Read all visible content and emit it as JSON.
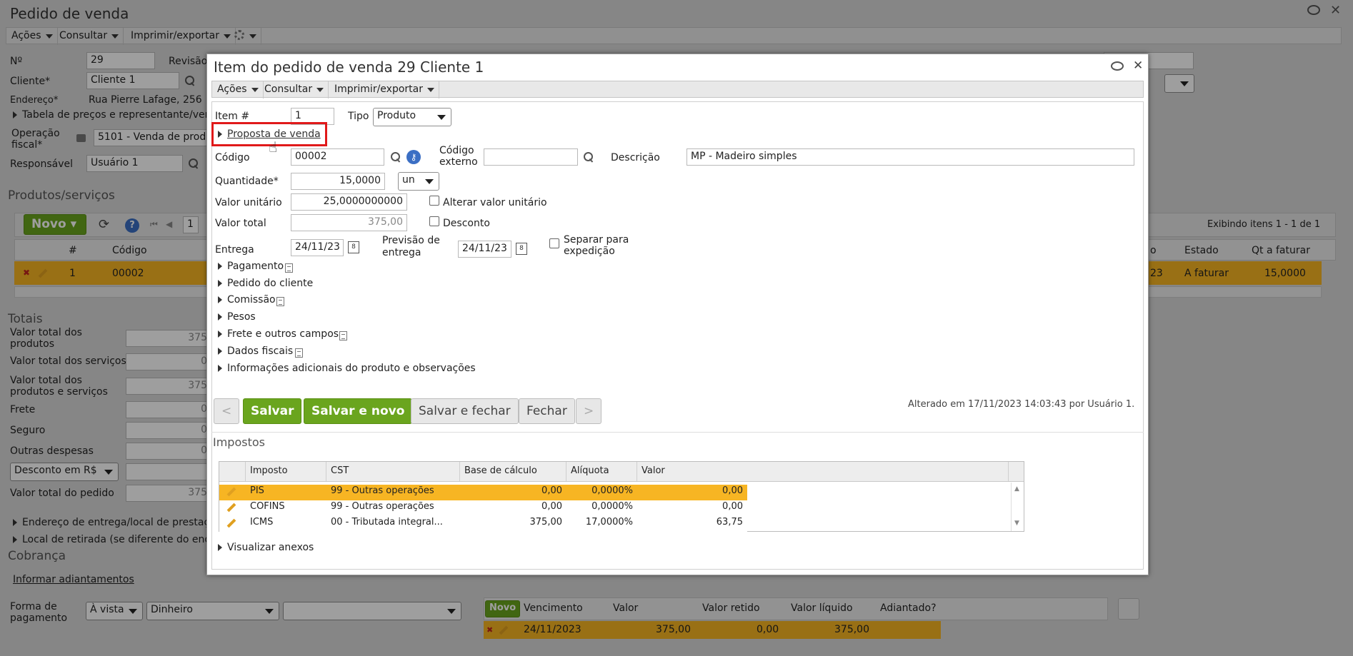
{
  "background": {
    "page_title": "Pedido de venda",
    "menu": [
      "Ações",
      "Consultar",
      "Imprimir/exportar"
    ],
    "fields": {
      "numero_label": "Nº",
      "numero_value": "29",
      "revisao_label": "Revisão",
      "cliente_label": "Cliente*",
      "cliente_value": "Cliente 1",
      "endereco_label": "Endereço*",
      "endereco_value": "Rua Pierre Lafage, 256",
      "tabela_label": "Tabela de preços e representante/vend",
      "operacao_label_1": "Operação",
      "operacao_label_2": "fiscal*",
      "operacao_value": "5101 - Venda de produ",
      "responsavel_label": "Responsável",
      "responsavel_value": "Usuário 1"
    },
    "produtos": {
      "section_title": "Produtos/serviços",
      "novo_label": "Novo",
      "page_value": "1",
      "exibindo": "Exibindo itens 1 - 1 de 1",
      "col_num": "#",
      "col_codigo": "Código",
      "col_o": "o",
      "col_estado": "Estado",
      "col_qt": "Qt a faturar",
      "row_num": "1",
      "row_codigo": "00002",
      "row_o": "23",
      "row_estado": "A faturar",
      "row_qt": "15,0000"
    },
    "totais": {
      "section_title": "Totais",
      "rows": [
        {
          "label_1": "Valor total dos",
          "label_2": "produtos",
          "value": "375"
        },
        {
          "label_1": "Valor total dos serviços",
          "label_2": "",
          "value": "0"
        },
        {
          "label_1": "Valor total dos",
          "label_2": "produtos e serviços",
          "value": "375"
        },
        {
          "label_1": "Frete",
          "label_2": "",
          "value": "0"
        },
        {
          "label_1": "Seguro",
          "label_2": "",
          "value": "0"
        },
        {
          "label_1": "Outras despesas",
          "label_2": "",
          "value": "0"
        },
        {
          "label_1": "Valor total do pedido",
          "label_2": "",
          "value": "375"
        }
      ],
      "desconto_select": "Desconto em R$"
    },
    "endereco_entrega": "Endereço de entrega/local de prestaçã",
    "local_retirada": "Local de retirada (se diferente do ende",
    "cobranca": {
      "section_title": "Cobrança",
      "adiantamentos_link": "Informar adiantamentos",
      "forma_label_1": "Forma de",
      "forma_label_2": "pagamento",
      "forma_value": "À vista",
      "meio_value": "Dinheiro",
      "extra_value": "",
      "novo_label": "Novo",
      "cols": [
        "Vencimento",
        "Valor",
        "Valor retido",
        "Valor líquido",
        "Adiantado?"
      ],
      "row": [
        "24/11/2023",
        "375,00",
        "0,00",
        "375,00",
        ""
      ]
    }
  },
  "modal": {
    "title": "Item do pedido de venda 29 Cliente 1",
    "menu": [
      "Ações",
      "Consultar",
      "Imprimir/exportar"
    ],
    "item_label": "Item #",
    "item_value": "1",
    "tipo_label": "Tipo",
    "tipo_value": "Produto",
    "proposta_link": "Proposta de venda",
    "codigo_label": "Código",
    "codigo_value": "00002",
    "codigo_externo_label_1": "Código",
    "codigo_externo_label_2": "externo",
    "codigo_externo_value": "",
    "descricao_label": "Descrição",
    "descricao_value": "MP - Madeiro simples",
    "quantidade_label": "Quantidade*",
    "quantidade_value": "15,0000",
    "unidade_value": "un",
    "valor_unitario_label": "Valor unitário",
    "valor_unitario_value": "25,0000000000",
    "alterar_valor_label": "Alterar valor unitário",
    "valor_total_label": "Valor total",
    "valor_total_value": "375,00",
    "desconto_label": "Desconto",
    "entrega_label": "Entrega",
    "entrega_value": "24/11/23",
    "previsao_label_1": "Previsão de",
    "previsao_label_2": "entrega",
    "previsao_value": "24/11/23",
    "separar_label_1": "Separar para",
    "separar_label_2": "expedição",
    "calendar_glyph": "8",
    "sections": [
      {
        "label": "Pagamento",
        "doc": true
      },
      {
        "label": "Pedido do cliente",
        "doc": false
      },
      {
        "label": "Comissão",
        "doc": true
      },
      {
        "label": "Pesos",
        "doc": false
      },
      {
        "label": "Frete e outros campos",
        "doc": true
      },
      {
        "label": "Dados fiscais",
        "doc": true
      },
      {
        "label": "Informações adicionais do produto e observações",
        "doc": false
      }
    ],
    "buttons": {
      "prev": "<",
      "salvar": "Salvar",
      "salvar_novo": "Salvar e novo",
      "salvar_fechar": "Salvar e fechar",
      "fechar": "Fechar",
      "next": ">"
    },
    "alterado": "Alterado em 17/11/2023 14:03:43 por Usuário 1.",
    "impostos": {
      "title": "Impostos",
      "cols": [
        "Imposto",
        "CST",
        "Base de cálculo",
        "Alíquota",
        "Valor"
      ],
      "rows": [
        {
          "imposto": "PIS",
          "cst": "99 - Outras operações",
          "base": "0,00",
          "aliquota": "0,0000%",
          "valor": "0,00"
        },
        {
          "imposto": "COFINS",
          "cst": "99 - Outras operações",
          "base": "0,00",
          "aliquota": "0,0000%",
          "valor": "0,00"
        },
        {
          "imposto": "ICMS",
          "cst": "00 - Tributada integral...",
          "base": "375,00",
          "aliquota": "17,0000%",
          "valor": "63,75"
        }
      ]
    },
    "visualizar_anexos": "Visualizar anexos"
  },
  "colors": {
    "accent_green": "#6aa51e",
    "selected_row": "#f7b523",
    "highlight_red": "#e0191a"
  }
}
